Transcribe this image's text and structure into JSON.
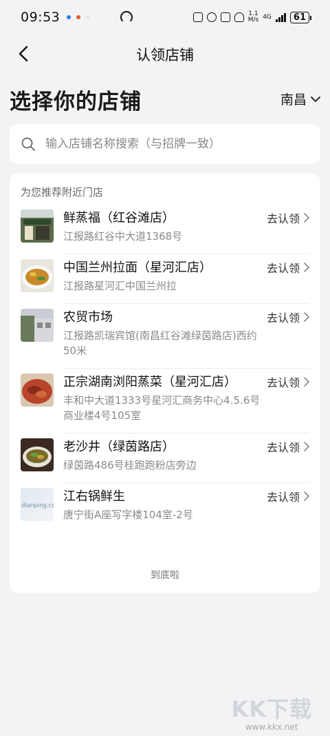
{
  "status": {
    "time": "09:53",
    "net_speed": "1.1",
    "net_unit": "M/s",
    "network": "4G",
    "battery": "61"
  },
  "nav": {
    "title": "认领店铺"
  },
  "header": {
    "title": "选择你的店铺",
    "city": "南昌"
  },
  "search": {
    "placeholder": "输入店铺名称搜索（与招牌一致）"
  },
  "section": {
    "label": "为您推荐附近门店"
  },
  "stores": [
    {
      "name": "鲜蒸福（红谷滩店）",
      "address": "江报路红谷中大道1368号",
      "action": "去认领"
    },
    {
      "name": "中国兰州拉面（星河汇店）",
      "address": "江报路星河汇中国兰州拉",
      "action": "去认领"
    },
    {
      "name": "农贸市场",
      "address": "江报路凯瑞宾馆(南昌红谷滩绿茵路店)西约50米",
      "action": "去认领"
    },
    {
      "name": "正宗湖南浏阳蒸菜（星河汇店）",
      "address": "丰和中大道1333号星河汇商务中心4.5.6号商业楼4号105室",
      "action": "去认领"
    },
    {
      "name": "老沙井（绿茵路店）",
      "address": "绿茵路486号桂跑跑粉店旁边",
      "action": "去认领"
    },
    {
      "name": "江右锅鲜生",
      "address": "唐宁街A座写字楼104室-2号",
      "action": "去认领"
    }
  ],
  "thumb_texts": {
    "last": "dianping.com"
  },
  "footer": {
    "text": "到底啦"
  },
  "watermark": {
    "big": "KK下载",
    "small": "www.kkx.net"
  }
}
